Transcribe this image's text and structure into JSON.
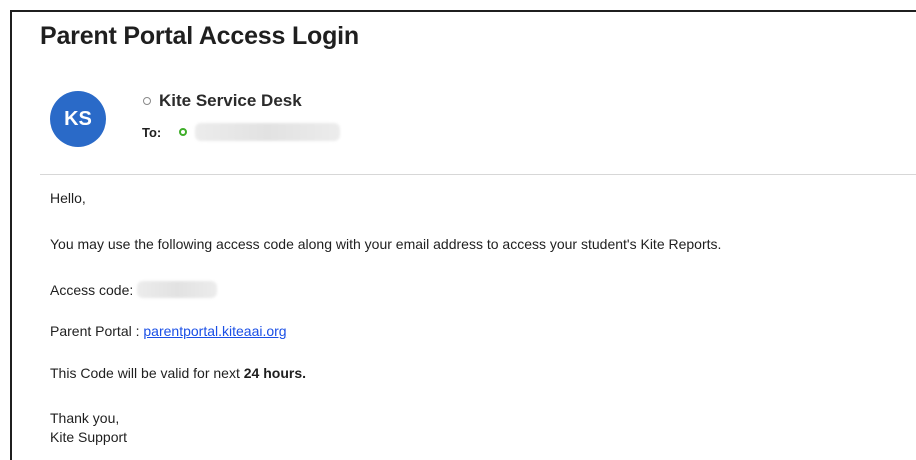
{
  "email": {
    "subject": "Parent Portal Access Login",
    "avatar_initials": "KS",
    "sender_name": "Kite Service Desk",
    "to_label": "To:",
    "body": {
      "greeting": "Hello,",
      "intro": "You may use the following access code along with your email address to access your student's Kite Reports.",
      "access_code_label": "Access code:",
      "portal_label": "Parent Portal : ",
      "portal_link": "parentportal.kiteaai.org",
      "validity_prefix": "This Code will be valid for next ",
      "validity_bold": "24 hours.",
      "closing": "Thank you,",
      "signature": "Kite Support"
    }
  },
  "colors": {
    "avatar_bg": "#2a6ac8",
    "link": "#1a4fe6",
    "presence_online": "#3fae2a",
    "presence_offline": "#8a8a8a"
  },
  "icons": {
    "sender_status": "presence-offline-icon",
    "recipient_status": "presence-online-icon"
  }
}
